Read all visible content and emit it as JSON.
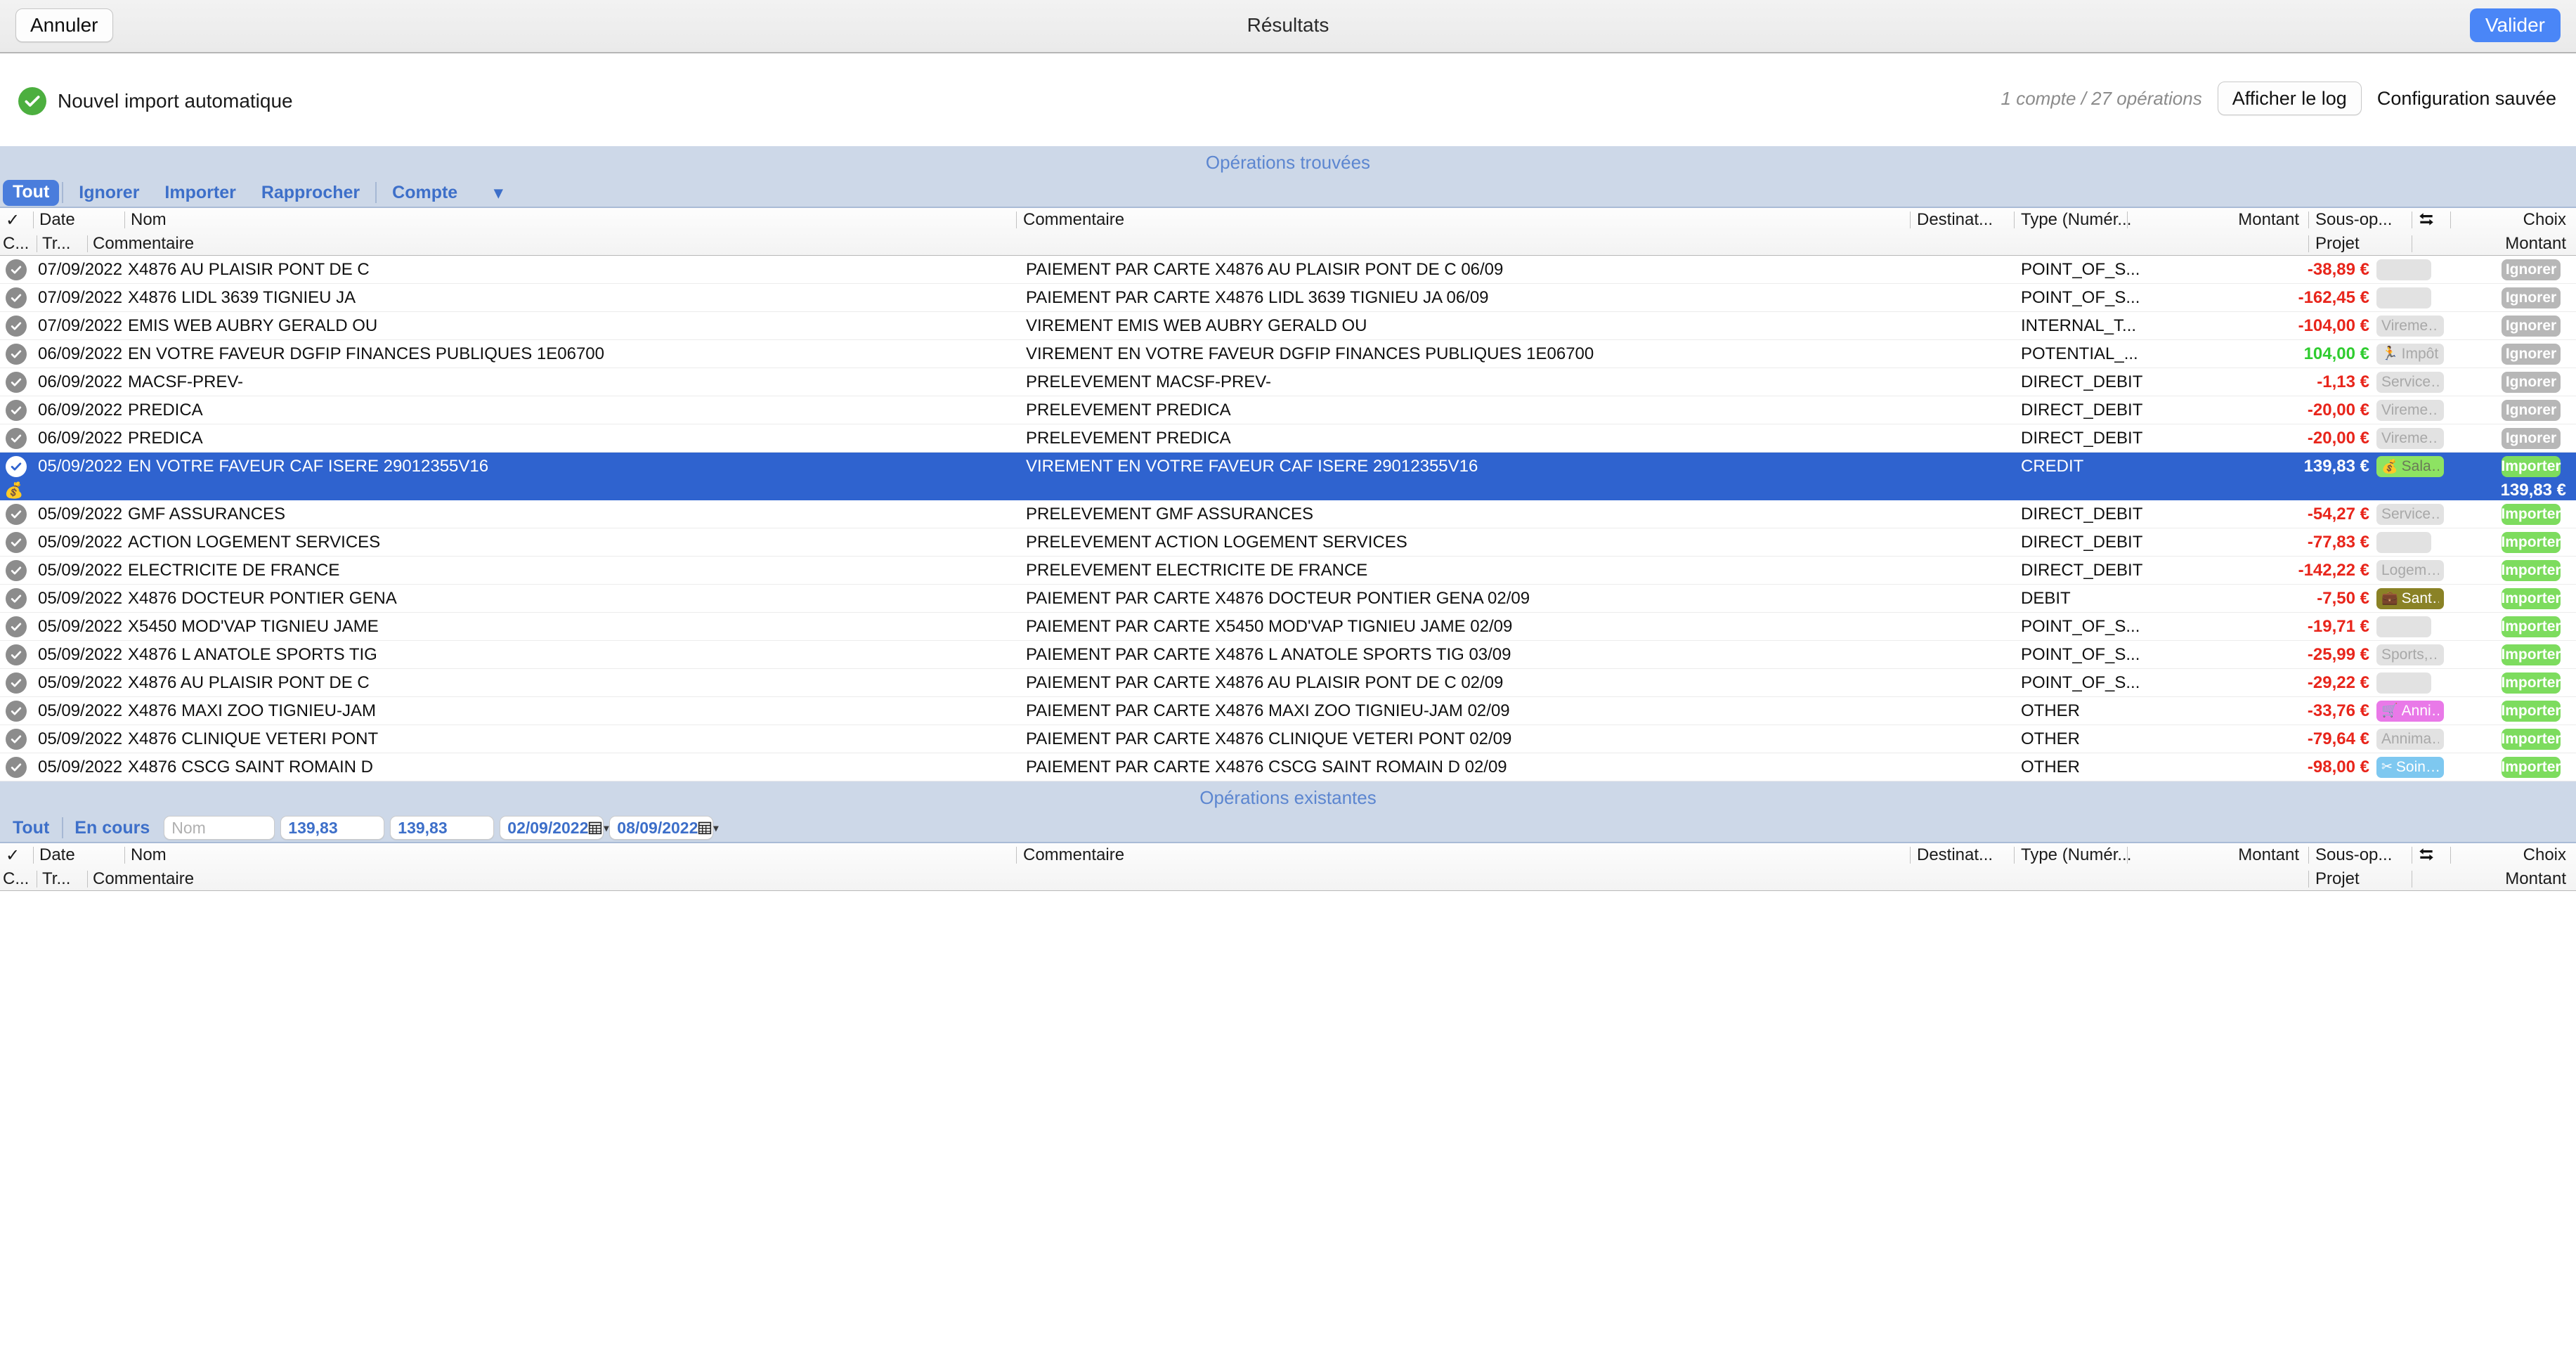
{
  "titlebar": {
    "cancel_label": "Annuler",
    "title": "Résultats",
    "validate_label": "Valider",
    "accent_blue": "#4a86f7"
  },
  "subheader": {
    "import_name": "Nouvel import automatique",
    "status_icon": "check-circle-icon",
    "ops_count": "1 compte / 27 opérations",
    "show_log_label": "Afficher le log",
    "config_saved_label": "Configuration sauvée",
    "status_color": "#4caf3f"
  },
  "found_section": {
    "banner": "Opérations trouvées",
    "filters": {
      "all_label": "Tout",
      "ignore_label": "Ignorer",
      "import_label": "Importer",
      "reconcile_label": "Rapprocher",
      "account_label": "Compte",
      "chevron_icon": "chevron-down-icon"
    },
    "columns_top": {
      "check": "✓",
      "date": "Date",
      "name": "Nom",
      "comment": "Commentaire",
      "destination": "Destinat...",
      "type": "Type (Numér...",
      "amount": "Montant",
      "sub_operation": "Sous-op...",
      "swap_icon": "swap-arrows-icon",
      "choice": "Choix"
    },
    "columns_bottom": {
      "c": "C...",
      "tr": "Tr...",
      "comment": "Commentaire",
      "project": "Projet",
      "amount": "Montant"
    },
    "rows": [
      {
        "date": "07/09/2022",
        "name": "X4876 AU PLAISIR PONT DE C",
        "comment": "PAIEMENT PAR CARTE X4876 AU PLAISIR PONT DE C 06/09",
        "type": "POINT_OF_S...",
        "amount": "-38,89 €",
        "amount_sign": "neg",
        "chip_label": "",
        "chip_icon": "",
        "chip_bg": "#e2e2e2",
        "chip_fg": "#a8a8a8",
        "choice": "Ignorer",
        "choice_kind": "ignorer",
        "selected": false
      },
      {
        "date": "07/09/2022",
        "name": "X4876 LIDL 3639 TIGNIEU JA",
        "comment": "PAIEMENT PAR CARTE X4876 LIDL 3639 TIGNIEU JA 06/09",
        "type": "POINT_OF_S...",
        "amount": "-162,45 €",
        "amount_sign": "neg",
        "chip_label": "",
        "chip_icon": "",
        "chip_bg": "#e2e2e2",
        "chip_fg": "#a8a8a8",
        "choice": "Ignorer",
        "choice_kind": "ignorer",
        "selected": false
      },
      {
        "date": "07/09/2022",
        "name": "EMIS WEB AUBRY GERALD OU",
        "comment": "VIREMENT EMIS WEB AUBRY GERALD OU",
        "type": "INTERNAL_T...",
        "amount": "-104,00 €",
        "amount_sign": "neg",
        "chip_label": "Vireme…",
        "chip_icon": "",
        "chip_bg": "#e2e2e2",
        "chip_fg": "#a8a8a8",
        "choice": "Ignorer",
        "choice_kind": "ignorer",
        "selected": false
      },
      {
        "date": "06/09/2022",
        "name": "EN VOTRE FAVEUR DGFIP FINANCES PUBLIQUES 1E06700",
        "comment": "VIREMENT EN VOTRE FAVEUR DGFIP FINANCES PUBLIQUES 1E06700",
        "type": "POTENTIAL_...",
        "amount": "104,00 €",
        "amount_sign": "pos",
        "chip_label": "Impôts",
        "chip_icon": "🏃",
        "chip_bg": "#e2e2e2",
        "chip_fg": "#a8a8a8",
        "choice": "Ignorer",
        "choice_kind": "ignorer",
        "selected": false
      },
      {
        "date": "06/09/2022",
        "name": "MACSF-PREV-",
        "comment": "PRELEVEMENT MACSF-PREV-",
        "type": "DIRECT_DEBIT",
        "amount": "-1,13 €",
        "amount_sign": "neg",
        "chip_label": "Service…",
        "chip_icon": "",
        "chip_bg": "#e2e2e2",
        "chip_fg": "#a8a8a8",
        "choice": "Ignorer",
        "choice_kind": "ignorer",
        "selected": false
      },
      {
        "date": "06/09/2022",
        "name": "PREDICA",
        "comment": "PRELEVEMENT PREDICA",
        "type": "DIRECT_DEBIT",
        "amount": "-20,00 €",
        "amount_sign": "neg",
        "chip_label": "Vireme…",
        "chip_icon": "",
        "chip_bg": "#e2e2e2",
        "chip_fg": "#a8a8a8",
        "choice": "Ignorer",
        "choice_kind": "ignorer",
        "selected": false
      },
      {
        "date": "06/09/2022",
        "name": "PREDICA",
        "comment": "PRELEVEMENT PREDICA",
        "type": "DIRECT_DEBIT",
        "amount": "-20,00 €",
        "amount_sign": "neg",
        "chip_label": "Vireme…",
        "chip_icon": "",
        "chip_bg": "#e2e2e2",
        "chip_fg": "#a8a8a8",
        "choice": "Ignorer",
        "choice_kind": "ignorer",
        "selected": false
      },
      {
        "date": "05/09/2022",
        "name": "EN VOTRE FAVEUR CAF ISERE 29012355V16",
        "comment": "VIREMENT EN VOTRE FAVEUR CAF ISERE 29012355V16",
        "type": "CREDIT",
        "amount": "139,83 €",
        "amount_sign": "white",
        "chip_label": "Sala…",
        "chip_icon": "💰",
        "chip_bg": "#8de362",
        "chip_fg": "#6a7a58",
        "choice": "Importer",
        "choice_kind": "importer",
        "selected": true,
        "sub_amount": "139,83 €"
      },
      {
        "date": "05/09/2022",
        "name": "GMF ASSURANCES",
        "comment": "PRELEVEMENT GMF ASSURANCES",
        "type": "DIRECT_DEBIT",
        "amount": "-54,27 €",
        "amount_sign": "neg",
        "chip_label": "Service…",
        "chip_icon": "",
        "chip_bg": "#e2e2e2",
        "chip_fg": "#a8a8a8",
        "choice": "Importer",
        "choice_kind": "importer",
        "selected": false
      },
      {
        "date": "05/09/2022",
        "name": "ACTION LOGEMENT SERVICES",
        "comment": "PRELEVEMENT ACTION LOGEMENT SERVICES",
        "type": "DIRECT_DEBIT",
        "amount": "-77,83 €",
        "amount_sign": "neg",
        "chip_label": "",
        "chip_icon": "",
        "chip_bg": "#e2e2e2",
        "chip_fg": "#a8a8a8",
        "choice": "Importer",
        "choice_kind": "importer",
        "selected": false
      },
      {
        "date": "05/09/2022",
        "name": "ELECTRICITE DE FRANCE",
        "comment": "PRELEVEMENT ELECTRICITE DE FRANCE",
        "type": "DIRECT_DEBIT",
        "amount": "-142,22 €",
        "amount_sign": "neg",
        "chip_label": "Logem…",
        "chip_icon": "",
        "chip_bg": "#e2e2e2",
        "chip_fg": "#a8a8a8",
        "choice": "Importer",
        "choice_kind": "importer",
        "selected": false
      },
      {
        "date": "05/09/2022",
        "name": "X4876 DOCTEUR PONTIER GENA",
        "comment": "PAIEMENT PAR CARTE X4876 DOCTEUR PONTIER GENA 02/09",
        "type": "DEBIT",
        "amount": "-7,50 €",
        "amount_sign": "neg",
        "chip_label": "Sant…",
        "chip_icon": "💼",
        "chip_bg": "#8a8226",
        "chip_fg": "#ffffff",
        "choice": "Importer",
        "choice_kind": "importer",
        "selected": false
      },
      {
        "date": "05/09/2022",
        "name": "X5450 MOD'VAP TIGNIEU JAME",
        "comment": "PAIEMENT PAR CARTE X5450 MOD'VAP TIGNIEU JAME 02/09",
        "type": "POINT_OF_S...",
        "amount": "-19,71 €",
        "amount_sign": "neg",
        "chip_label": "",
        "chip_icon": "",
        "chip_bg": "#e2e2e2",
        "chip_fg": "#a8a8a8",
        "choice": "Importer",
        "choice_kind": "importer",
        "selected": false
      },
      {
        "date": "05/09/2022",
        "name": "X4876 L ANATOLE SPORTS TIG",
        "comment": "PAIEMENT PAR CARTE X4876 L ANATOLE SPORTS TIG 03/09",
        "type": "POINT_OF_S...",
        "amount": "-25,99 €",
        "amount_sign": "neg",
        "chip_label": "Sports,…",
        "chip_icon": "",
        "chip_bg": "#e2e2e2",
        "chip_fg": "#a8a8a8",
        "choice": "Importer",
        "choice_kind": "importer",
        "selected": false
      },
      {
        "date": "05/09/2022",
        "name": "X4876 AU PLAISIR PONT DE C",
        "comment": "PAIEMENT PAR CARTE X4876 AU PLAISIR PONT DE C 02/09",
        "type": "POINT_OF_S...",
        "amount": "-29,22 €",
        "amount_sign": "neg",
        "chip_label": "",
        "chip_icon": "",
        "chip_bg": "#e2e2e2",
        "chip_fg": "#a8a8a8",
        "choice": "Importer",
        "choice_kind": "importer",
        "selected": false
      },
      {
        "date": "05/09/2022",
        "name": "X4876 MAXI ZOO TIGNIEU-JAM",
        "comment": "PAIEMENT PAR CARTE X4876 MAXI ZOO TIGNIEU-JAM 02/09",
        "type": "OTHER",
        "amount": "-33,76 €",
        "amount_sign": "neg",
        "chip_label": "Anni…",
        "chip_icon": "🛒",
        "chip_bg": "#e979e8",
        "chip_fg": "#ffffff",
        "choice": "Importer",
        "choice_kind": "importer",
        "selected": false
      },
      {
        "date": "05/09/2022",
        "name": "X4876 CLINIQUE VETERI PONT",
        "comment": "PAIEMENT PAR CARTE X4876 CLINIQUE VETERI PONT 02/09",
        "type": "OTHER",
        "amount": "-79,64 €",
        "amount_sign": "neg",
        "chip_label": "Annima…",
        "chip_icon": "",
        "chip_bg": "#e2e2e2",
        "chip_fg": "#a8a8a8",
        "choice": "Importer",
        "choice_kind": "importer",
        "selected": false
      },
      {
        "date": "05/09/2022",
        "name": "X4876 CSCG SAINT ROMAIN D",
        "comment": "PAIEMENT PAR CARTE X4876 CSCG SAINT ROMAIN D 02/09",
        "type": "OTHER",
        "amount": "-98,00 €",
        "amount_sign": "neg",
        "chip_label": "Soin…",
        "chip_icon": "✂",
        "chip_bg": "#7ec8f0",
        "chip_fg": "#ffffff",
        "choice": "Importer",
        "choice_kind": "importer",
        "selected": false
      }
    ]
  },
  "existing_section": {
    "banner": "Opérations existantes",
    "filters": {
      "all_label": "Tout",
      "current_label": "En cours",
      "name_placeholder": "Nom",
      "amount_min": "139,83",
      "amount_max": "139,83",
      "date_from": "02/09/2022",
      "date_to": "08/09/2022",
      "calendar_icon": "calendar-icon"
    },
    "columns_top": {
      "check": "✓",
      "date": "Date",
      "name": "Nom",
      "comment": "Commentaire",
      "destination": "Destinat...",
      "type": "Type (Numér...",
      "amount": "Montant",
      "sub_operation": "Sous-op...",
      "swap_icon": "swap-arrows-icon",
      "choice": "Choix"
    },
    "columns_bottom": {
      "c": "C...",
      "tr": "Tr...",
      "comment": "Commentaire",
      "project": "Projet",
      "amount": "Montant"
    },
    "rows": []
  }
}
